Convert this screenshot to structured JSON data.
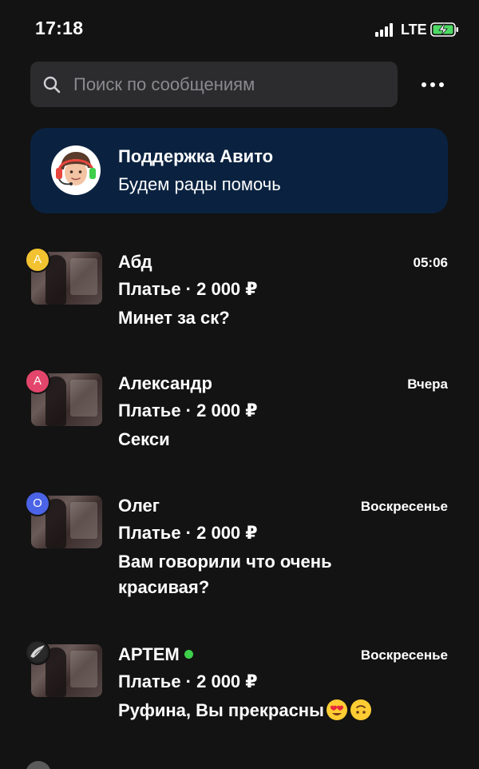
{
  "status_bar": {
    "time": "17:18",
    "network": "LTE",
    "battery_state": "charging"
  },
  "search": {
    "placeholder": "Поиск по сообщениям",
    "value": ""
  },
  "support": {
    "title": "Поддержка Авито",
    "subtitle": "Будем рады помочь"
  },
  "chats": [
    {
      "name": "Абд",
      "badge_letter": "А",
      "badge_color": "#f2c230",
      "time": "05:06",
      "item": "Платье · 2 000 ₽",
      "message": "Минет за ск?",
      "online": false
    },
    {
      "name": "Александр",
      "badge_letter": "А",
      "badge_color": "#e3456b",
      "time": "Вчера",
      "item": "Платье · 2 000 ₽",
      "message": "Секси",
      "online": false
    },
    {
      "name": "Олег",
      "badge_letter": "О",
      "badge_color": "#4b63e6",
      "time": "Воскресенье",
      "item": "Платье · 2 000 ₽",
      "message": "Вам говорили что очень красивая?",
      "online": false
    },
    {
      "name": "АРТЕМ",
      "badge_letter": "",
      "badge_color": "#222222",
      "time": "Воскресенье",
      "item": "Платье · 2 000 ₽",
      "message": "Руфина, Вы прекрасны",
      "online": true,
      "emojis": [
        "heart-eyes-emoji",
        "upside-down-face-emoji"
      ]
    }
  ],
  "colors": {
    "background": "#131313",
    "search_bg": "#2c2c2e",
    "support_card_bg": "#0a2240",
    "online": "#3ecf4b",
    "placeholder": "#8b8b8f"
  }
}
